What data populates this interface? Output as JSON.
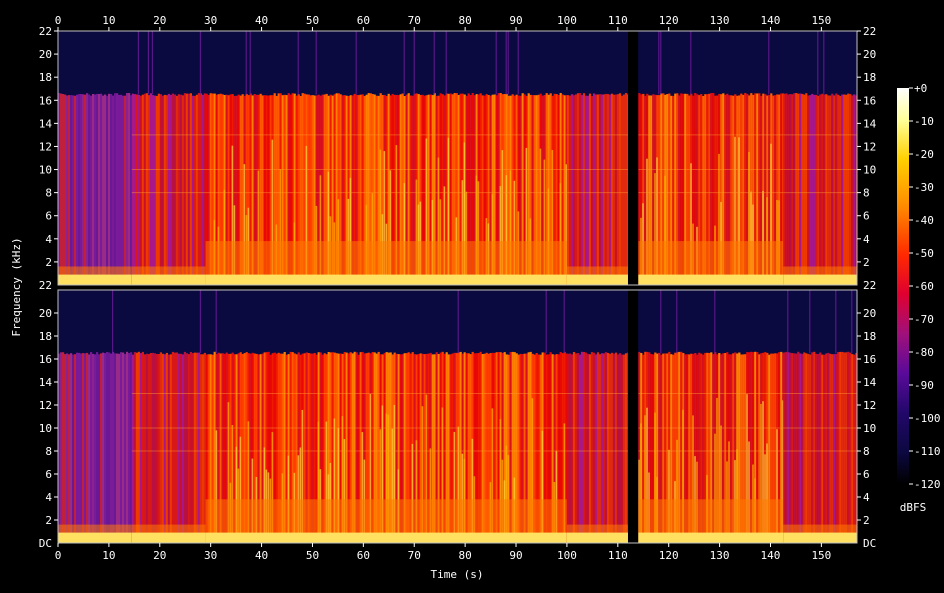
{
  "chart_data": {
    "type": "heatmap",
    "title": "",
    "xlabel": "Time (s)",
    "ylabel": "Frequency (kHz)",
    "xlim": [
      0,
      157
    ],
    "ylim": [
      0,
      22
    ],
    "x_ticks": [
      0,
      10,
      20,
      30,
      40,
      50,
      60,
      70,
      80,
      90,
      100,
      110,
      120,
      130,
      140,
      150
    ],
    "y_ticks": [
      2,
      4,
      6,
      8,
      10,
      12,
      14,
      16,
      18,
      20,
      22
    ],
    "y_bottom_label": "DC",
    "channels": 2,
    "cutoff_khz": 16.5,
    "gap": [
      112,
      114
    ],
    "segments": [
      {
        "from": 0,
        "to": 14.5,
        "level": "low"
      },
      {
        "from": 14.5,
        "to": 29,
        "level": "mid"
      },
      {
        "from": 29,
        "to": 100,
        "level": "high"
      },
      {
        "from": 100,
        "to": 112,
        "level": "mid"
      },
      {
        "from": 114,
        "to": 142.5,
        "level": "high"
      },
      {
        "from": 142.5,
        "to": 157,
        "level": "mid"
      }
    ],
    "colorbar": {
      "unit": "dBFS",
      "range": [
        -120,
        0
      ],
      "ticks": [
        "+0",
        "-10",
        "-20",
        "-30",
        "-40",
        "-50",
        "-60",
        "-70",
        "-80",
        "-90",
        "-100",
        "-110",
        "-120"
      ]
    }
  }
}
